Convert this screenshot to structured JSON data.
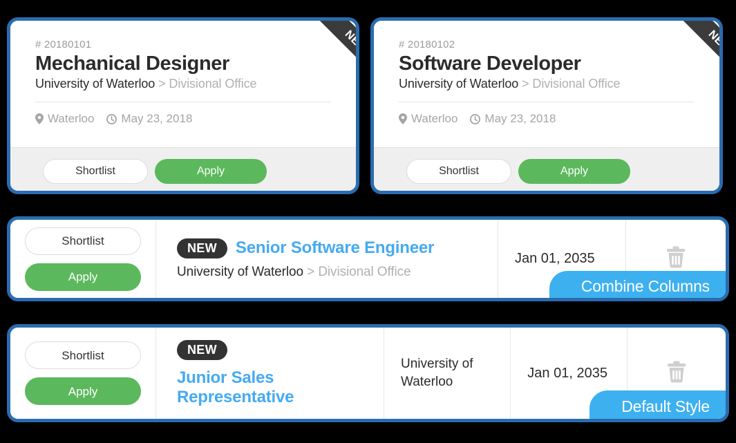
{
  "colors": {
    "card_border": "#2a6cb0",
    "apply_green": "#5cb85c",
    "link_blue": "#45aaf2",
    "tab_blue": "#3db0f0",
    "ribbon_dark": "#3b3b3b",
    "pill_dark": "#333333",
    "footer_gray": "#efefef",
    "muted_text": "#b0b0b0",
    "page_background": "#000000"
  },
  "common": {
    "shortlist_label": "Shortlist",
    "apply_label": "Apply",
    "new_label": "NEW",
    "breadcrumb_separator": ">",
    "trash_icon": "trash-icon",
    "location_icon": "map-pin-icon",
    "clock_icon": "clock-icon"
  },
  "grid_cards": [
    {
      "id_label": "# 20180101",
      "title": "Mechanical Designer",
      "organization": "University of Waterloo",
      "department": "Divisional Office",
      "location": "Waterloo",
      "date": "May 23, 2018",
      "ribbon_label": "NEW",
      "shortlist_label": "Shortlist",
      "apply_label": "Apply"
    },
    {
      "id_label": "# 20180102",
      "title": "Software Developer",
      "organization": "University of Waterloo",
      "department": "Divisional Office",
      "location": "Waterloo",
      "date": "May 23, 2018",
      "ribbon_label": "NEW",
      "shortlist_label": "Shortlist",
      "apply_label": "Apply"
    }
  ],
  "row_cards": [
    {
      "style_label": "Combine Columns",
      "new_label": "NEW",
      "title": "Senior Software Engineer",
      "organization": "University of Waterloo",
      "department": "Divisional Office",
      "date": "Jan 01, 2035",
      "shortlist_label": "Shortlist",
      "apply_label": "Apply"
    },
    {
      "style_label": "Default Style",
      "new_label": "NEW",
      "title": "Junior Sales Representative",
      "organization": "University of Waterloo",
      "date": "Jan 01, 2035",
      "shortlist_label": "Shortlist",
      "apply_label": "Apply"
    }
  ]
}
